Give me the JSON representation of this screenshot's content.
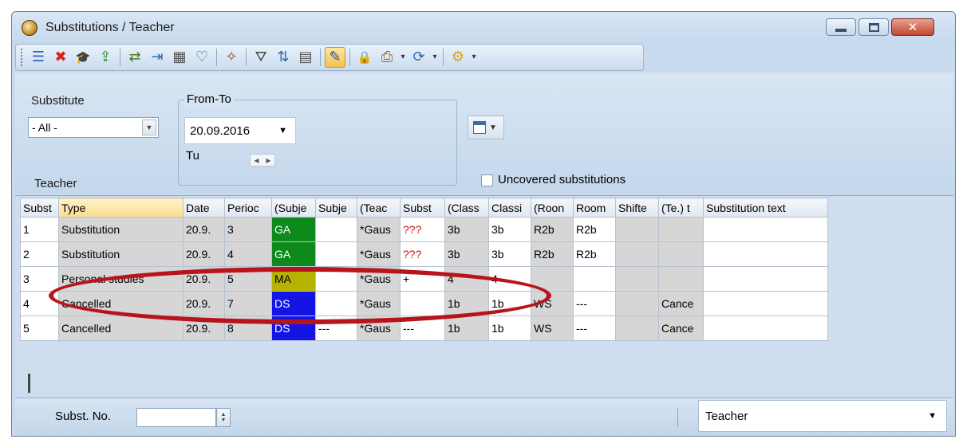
{
  "window": {
    "title": "Substitutions / Teacher"
  },
  "toolbar": {
    "buttons": [
      {
        "icon": "list-icon",
        "glyph": "☰"
      },
      {
        "icon": "delete-icon",
        "glyph": "✖"
      },
      {
        "icon": "graduation-cap-icon",
        "glyph": "🎓"
      },
      {
        "icon": "import-icon",
        "glyph": "⇪"
      },
      {
        "icon": "swap-icon",
        "glyph": "⇄"
      },
      {
        "icon": "assign-icon",
        "glyph": "⇥"
      },
      {
        "icon": "calculator-icon",
        "glyph": "▦"
      },
      {
        "icon": "stethoscope-icon",
        "glyph": "♡"
      },
      {
        "icon": "wand-icon",
        "glyph": "✧"
      },
      {
        "icon": "filter-icon",
        "glyph": "⛛"
      },
      {
        "icon": "sort-icon",
        "glyph": "⇅"
      },
      {
        "icon": "grid-settings-icon",
        "glyph": "▤"
      },
      {
        "icon": "edit-icon",
        "glyph": "✎"
      },
      {
        "icon": "lock-icon",
        "glyph": "🔒"
      },
      {
        "icon": "print-icon",
        "glyph": "⎙"
      },
      {
        "icon": "refresh-icon",
        "glyph": "⟳"
      },
      {
        "icon": "settings-gear-icon",
        "glyph": "⚙"
      }
    ]
  },
  "filters": {
    "substitute_label": "Substitute",
    "substitute_value": "- All -",
    "fromto_label": "From-To",
    "date_value": "20.09.2016",
    "weekday": "Tu",
    "teacher_label": "Teacher",
    "uncovered_label": "Uncovered substitutions"
  },
  "grid": {
    "columns": [
      "Subst",
      "Type",
      "Date",
      "Perioc",
      "(Subje",
      "Subje",
      "(Teac",
      "Subst",
      "(Class",
      "Classi",
      "(Roon",
      "Room",
      "Shifte",
      "(Te.) t",
      "Substitution text"
    ],
    "rows": [
      [
        "1",
        "Substitution",
        "20.9.",
        "3",
        "GA",
        "",
        "*Gaus",
        "???",
        "3b",
        "3b",
        "R2b",
        "R2b",
        "",
        "",
        ""
      ],
      [
        "2",
        "Substitution",
        "20.9.",
        "4",
        "GA",
        "",
        "*Gaus",
        "???",
        "3b",
        "3b",
        "R2b",
        "R2b",
        "",
        "",
        ""
      ],
      [
        "3",
        "Personal studies",
        "20.9.",
        "5",
        "MA",
        "",
        "*Gaus",
        "+",
        "4",
        "4",
        "",
        "",
        "",
        "",
        ""
      ],
      [
        "4",
        "Cancelled",
        "20.9.",
        "7",
        "DS",
        "",
        "*Gaus",
        "",
        "1b",
        "1b",
        "WS",
        "---",
        "",
        "Cance",
        ""
      ],
      [
        "5",
        "Cancelled",
        "20.9.",
        "8",
        "DS",
        "---",
        "*Gaus",
        "---",
        "1b",
        "1b",
        "WS",
        "---",
        "",
        "Cance",
        ""
      ]
    ]
  },
  "statusbar": {
    "substno_label": "Subst. No.",
    "view_value": "Teacher"
  },
  "colors": {
    "subject_green": "#0e8a1c",
    "subject_blue": "#1414e6",
    "subject_olive": "#b5b300",
    "annotation_red": "#b8141c"
  }
}
